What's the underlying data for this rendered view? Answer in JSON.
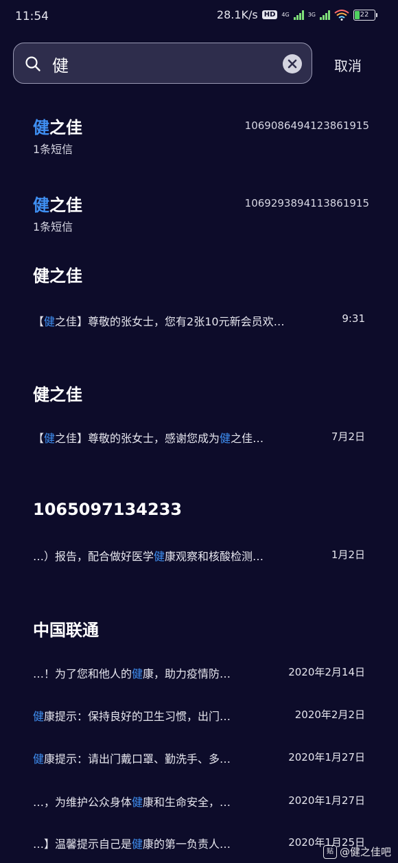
{
  "status_bar": {
    "time": "11:54",
    "speed": "28.1K/s",
    "hd": "HD",
    "net1": "4G",
    "net2": "3G",
    "battery": "22"
  },
  "search": {
    "query": "健",
    "placeholder": "",
    "cancel_label": "取消",
    "clear_icon": "close-icon",
    "search_icon": "search-icon"
  },
  "contacts": [
    {
      "name_hl": "健",
      "name_rest": "之佳",
      "number": "10690864941238619​15",
      "sub": "1条短信"
    },
    {
      "name_hl": "健",
      "name_rest": "之佳",
      "number": "1069293894113861915",
      "sub": "1条短信"
    }
  ],
  "threads": [
    {
      "title": "健之佳",
      "messages": [
        {
          "pre": "【",
          "hl": "健",
          "post": "之佳】尊敬的张女士，您有2张10元新会员欢…",
          "date": "9:31"
        }
      ]
    },
    {
      "title": "健之佳",
      "messages": [
        {
          "pre": "【",
          "hl": "健",
          "post": "之佳】尊敬的张女士，感谢您成为",
          "hl2": "健",
          "post2": "之佳…",
          "date": "7月2日"
        }
      ]
    },
    {
      "title": "1065097134233",
      "messages": [
        {
          "pre": "…）报告，配合做好医学",
          "hl": "健",
          "post": "康观察和核酸检测…",
          "date": "1月2日"
        }
      ]
    },
    {
      "title": "中国联通",
      "messages": [
        {
          "pre": "…！为了您和他人的",
          "hl": "健",
          "post": "康，助力疫情防…",
          "date": "2020年2月14日"
        },
        {
          "pre": "",
          "hl": "健",
          "post": "康提示：保持良好的卫生习惯，出门…",
          "date": "2020年2月2日"
        },
        {
          "pre": "",
          "hl": "健",
          "post": "康提示：请出门戴口罩、勤洗手、多…",
          "date": "2020年1月27日"
        },
        {
          "pre": "…，为维护公众身体",
          "hl": "健",
          "post": "康和生命安全，…",
          "date": "2020年1月27日"
        },
        {
          "pre": "…】温馨提示自己是",
          "hl": "健",
          "post": "康的第一负责人…",
          "date": "2020年1月25日"
        }
      ]
    }
  ],
  "colors": {
    "background": "#0d0c2a",
    "highlight": "#3f8ff2",
    "text": "#ffffff"
  },
  "watermark": "@健之佳吧"
}
